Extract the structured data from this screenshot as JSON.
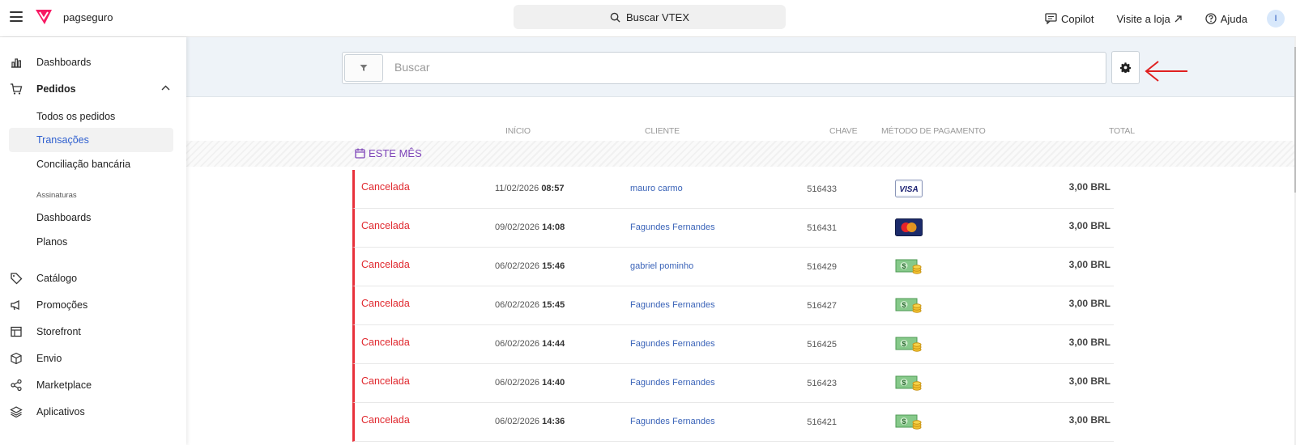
{
  "topbar": {
    "brand": "pagseguro",
    "search_label": "Buscar VTEX",
    "copilot": "Copilot",
    "visit_store": "Visite a loja",
    "help": "Ajuda",
    "avatar_initial": "I"
  },
  "sidebar": {
    "items": [
      {
        "label": "Dashboards",
        "icon": "bar-chart-icon"
      },
      {
        "label": "Pedidos",
        "icon": "cart-icon"
      },
      {
        "label": "Catálogo",
        "icon": "tag-icon"
      },
      {
        "label": "Promoções",
        "icon": "megaphone-icon"
      },
      {
        "label": "Storefront",
        "icon": "layout-icon"
      },
      {
        "label": "Envio",
        "icon": "box-icon"
      },
      {
        "label": "Marketplace",
        "icon": "share-icon"
      },
      {
        "label": "Aplicativos",
        "icon": "layers-icon"
      }
    ],
    "pedidos_sub": [
      "Todos os pedidos",
      "Transações",
      "Conciliação bancária"
    ],
    "subscriptions_label": "Assinaturas",
    "subscriptions_sub": [
      "Dashboards",
      "Planos"
    ]
  },
  "filter": {
    "search_placeholder": "Buscar"
  },
  "columns": {
    "start": "INÍCIO",
    "client": "CLIENTE",
    "key": "CHAVE",
    "payment": "MÉTODO DE PAGAMENTO",
    "total": "TOTAL"
  },
  "group_label": "ESTE MÊS",
  "rows": [
    {
      "status": "Cancelada",
      "date": "11/02/2026",
      "time": "08:57",
      "client": "mauro carmo",
      "key": "516433",
      "payment": "visa",
      "total": "3,00 BRL"
    },
    {
      "status": "Cancelada",
      "date": "09/02/2026",
      "time": "14:08",
      "client": "Fagundes Fernandes",
      "key": "516431",
      "payment": "mastercard",
      "total": "3,00 BRL"
    },
    {
      "status": "Cancelada",
      "date": "06/02/2026",
      "time": "15:46",
      "client": "gabriel pominho",
      "key": "516429",
      "payment": "cash",
      "total": "3,00 BRL"
    },
    {
      "status": "Cancelada",
      "date": "06/02/2026",
      "time": "15:45",
      "client": "Fagundes Fernandes",
      "key": "516427",
      "payment": "cash",
      "total": "3,00 BRL"
    },
    {
      "status": "Cancelada",
      "date": "06/02/2026",
      "time": "14:44",
      "client": "Fagundes Fernandes",
      "key": "516425",
      "payment": "cash",
      "total": "3,00 BRL"
    },
    {
      "status": "Cancelada",
      "date": "06/02/2026",
      "time": "14:40",
      "client": "Fagundes Fernandes",
      "key": "516423",
      "payment": "cash",
      "total": "3,00 BRL"
    },
    {
      "status": "Cancelada",
      "date": "06/02/2026",
      "time": "14:36",
      "client": "Fagundes Fernandes",
      "key": "516421",
      "payment": "cash",
      "total": "3,00 BRL"
    }
  ],
  "colors": {
    "accent": "#2e5fcf",
    "cancel": "#e0282e",
    "month": "#7d44b8",
    "annotation": "#e02020"
  }
}
